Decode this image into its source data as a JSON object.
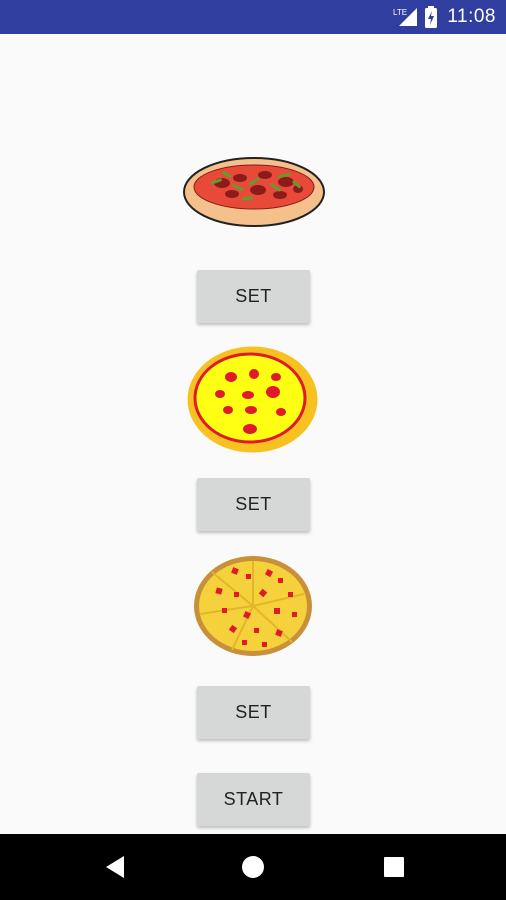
{
  "status_bar": {
    "network_label": "LTE",
    "time": "11:08"
  },
  "pizzas": [
    {
      "icon": "pepperoni-pizza-side-icon",
      "set_label": "SET"
    },
    {
      "icon": "cheese-pizza-icon",
      "set_label": "SET"
    },
    {
      "icon": "sliced-pizza-icon",
      "set_label": "SET"
    }
  ],
  "start_label": "START",
  "nav": {
    "back": "back-icon",
    "home": "home-icon",
    "recents": "recents-icon"
  }
}
